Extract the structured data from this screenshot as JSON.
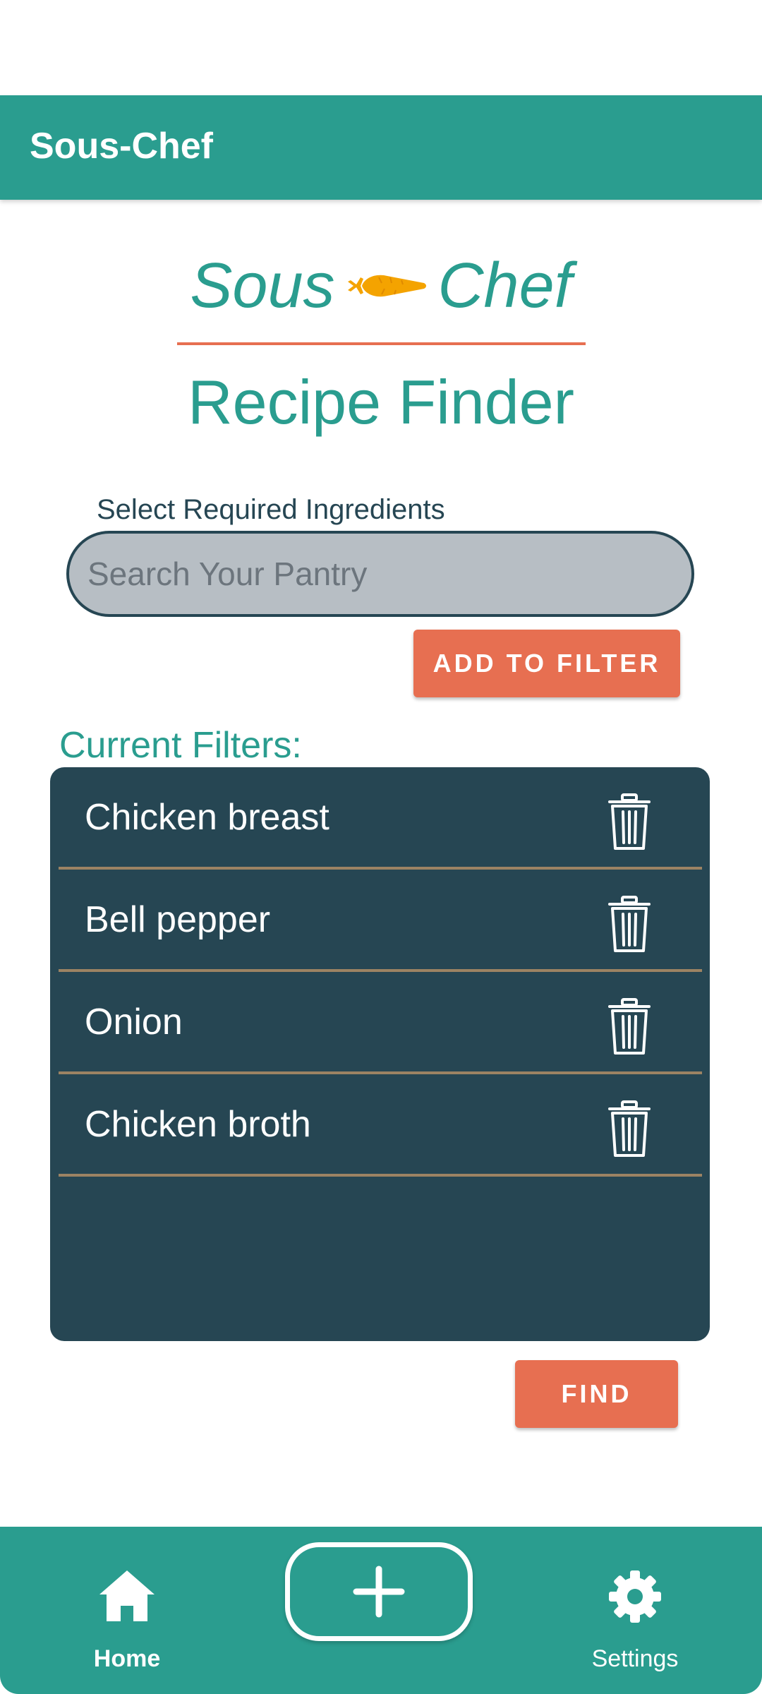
{
  "app_bar": {
    "title": "Sous-Chef"
  },
  "logo": {
    "left_text": "Sous",
    "right_text": "Chef",
    "icon": "carrot-icon"
  },
  "page": {
    "title": "Recipe Finder"
  },
  "search": {
    "label": "Select Required Ingredients",
    "placeholder": "Search Your Pantry",
    "value": ""
  },
  "buttons": {
    "add_filter": "ADD TO FILTER",
    "find": "FIND"
  },
  "filters": {
    "label": "Current Filters:",
    "items": [
      {
        "name": "Chicken breast",
        "icon": "trash-icon"
      },
      {
        "name": "Bell pepper",
        "icon": "trash-icon"
      },
      {
        "name": "Onion",
        "icon": "trash-icon"
      },
      {
        "name": "Chicken broth",
        "icon": "trash-icon"
      }
    ]
  },
  "bottom_nav": {
    "home": {
      "label": "Home",
      "icon": "home-icon",
      "active": true
    },
    "add": {
      "icon": "plus-icon"
    },
    "settings": {
      "label": "Settings",
      "icon": "gear-icon",
      "active": false
    }
  },
  "colors": {
    "primary": "#2a9d8f",
    "accent": "#e76f51",
    "dark": "#264653",
    "divider": "#9c8363",
    "carrot": "#f4a300",
    "input_bg": "#b7bec4"
  }
}
